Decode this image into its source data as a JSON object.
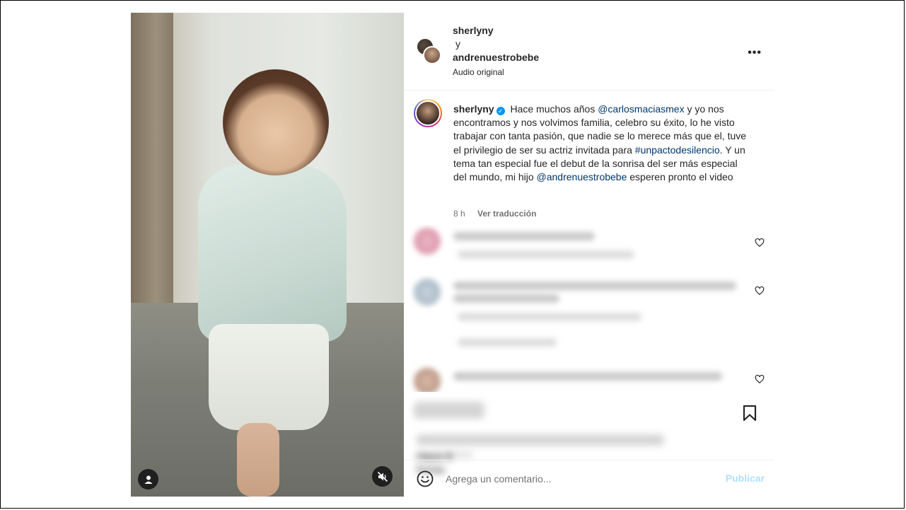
{
  "post": {
    "owner_1": "sherlyny",
    "conjunction": "y",
    "owner_2": "andrenuestrobebe",
    "audio": "Audio original",
    "more_label": "•••"
  },
  "caption": {
    "username": "sherlyny",
    "verified_glyph": "✓",
    "text_1": " Hace muchos años ",
    "mention_1": "@carlosmaciasmex",
    "text_2": " y yo nos encontramos y nos volvimos familia, celebro su éxito, lo he visto trabajar con tanta pasión, que nadie se lo merece más que el, tuve el privilegio de ser su actriz invitada para ",
    "hashtag_1": "#unpactodesilencio",
    "text_3": ". Y un tema tan especial fue el debut de la sonrisa del ser más especial del mundo, mi hijo ",
    "mention_2": "@andrenuestrobebe",
    "text_4": " esperen pronto el video",
    "time": "8 h",
    "translate": "Ver traducción"
  },
  "footer": {
    "likes_blurred": "Hace 8 horas"
  },
  "comment_box": {
    "placeholder": "Agrega un comentario...",
    "publish": "Publicar"
  },
  "icons": {
    "user": "user-icon",
    "mute": "mute-icon",
    "more": "more-options-icon",
    "verified": "verified-icon",
    "heart": "heart-icon",
    "bookmark": "bookmark-icon",
    "emoji": "emoji-icon"
  },
  "colors": {
    "link": "#00376b",
    "verified": "#0095f6",
    "publish_disabled": "#b2dffc"
  }
}
